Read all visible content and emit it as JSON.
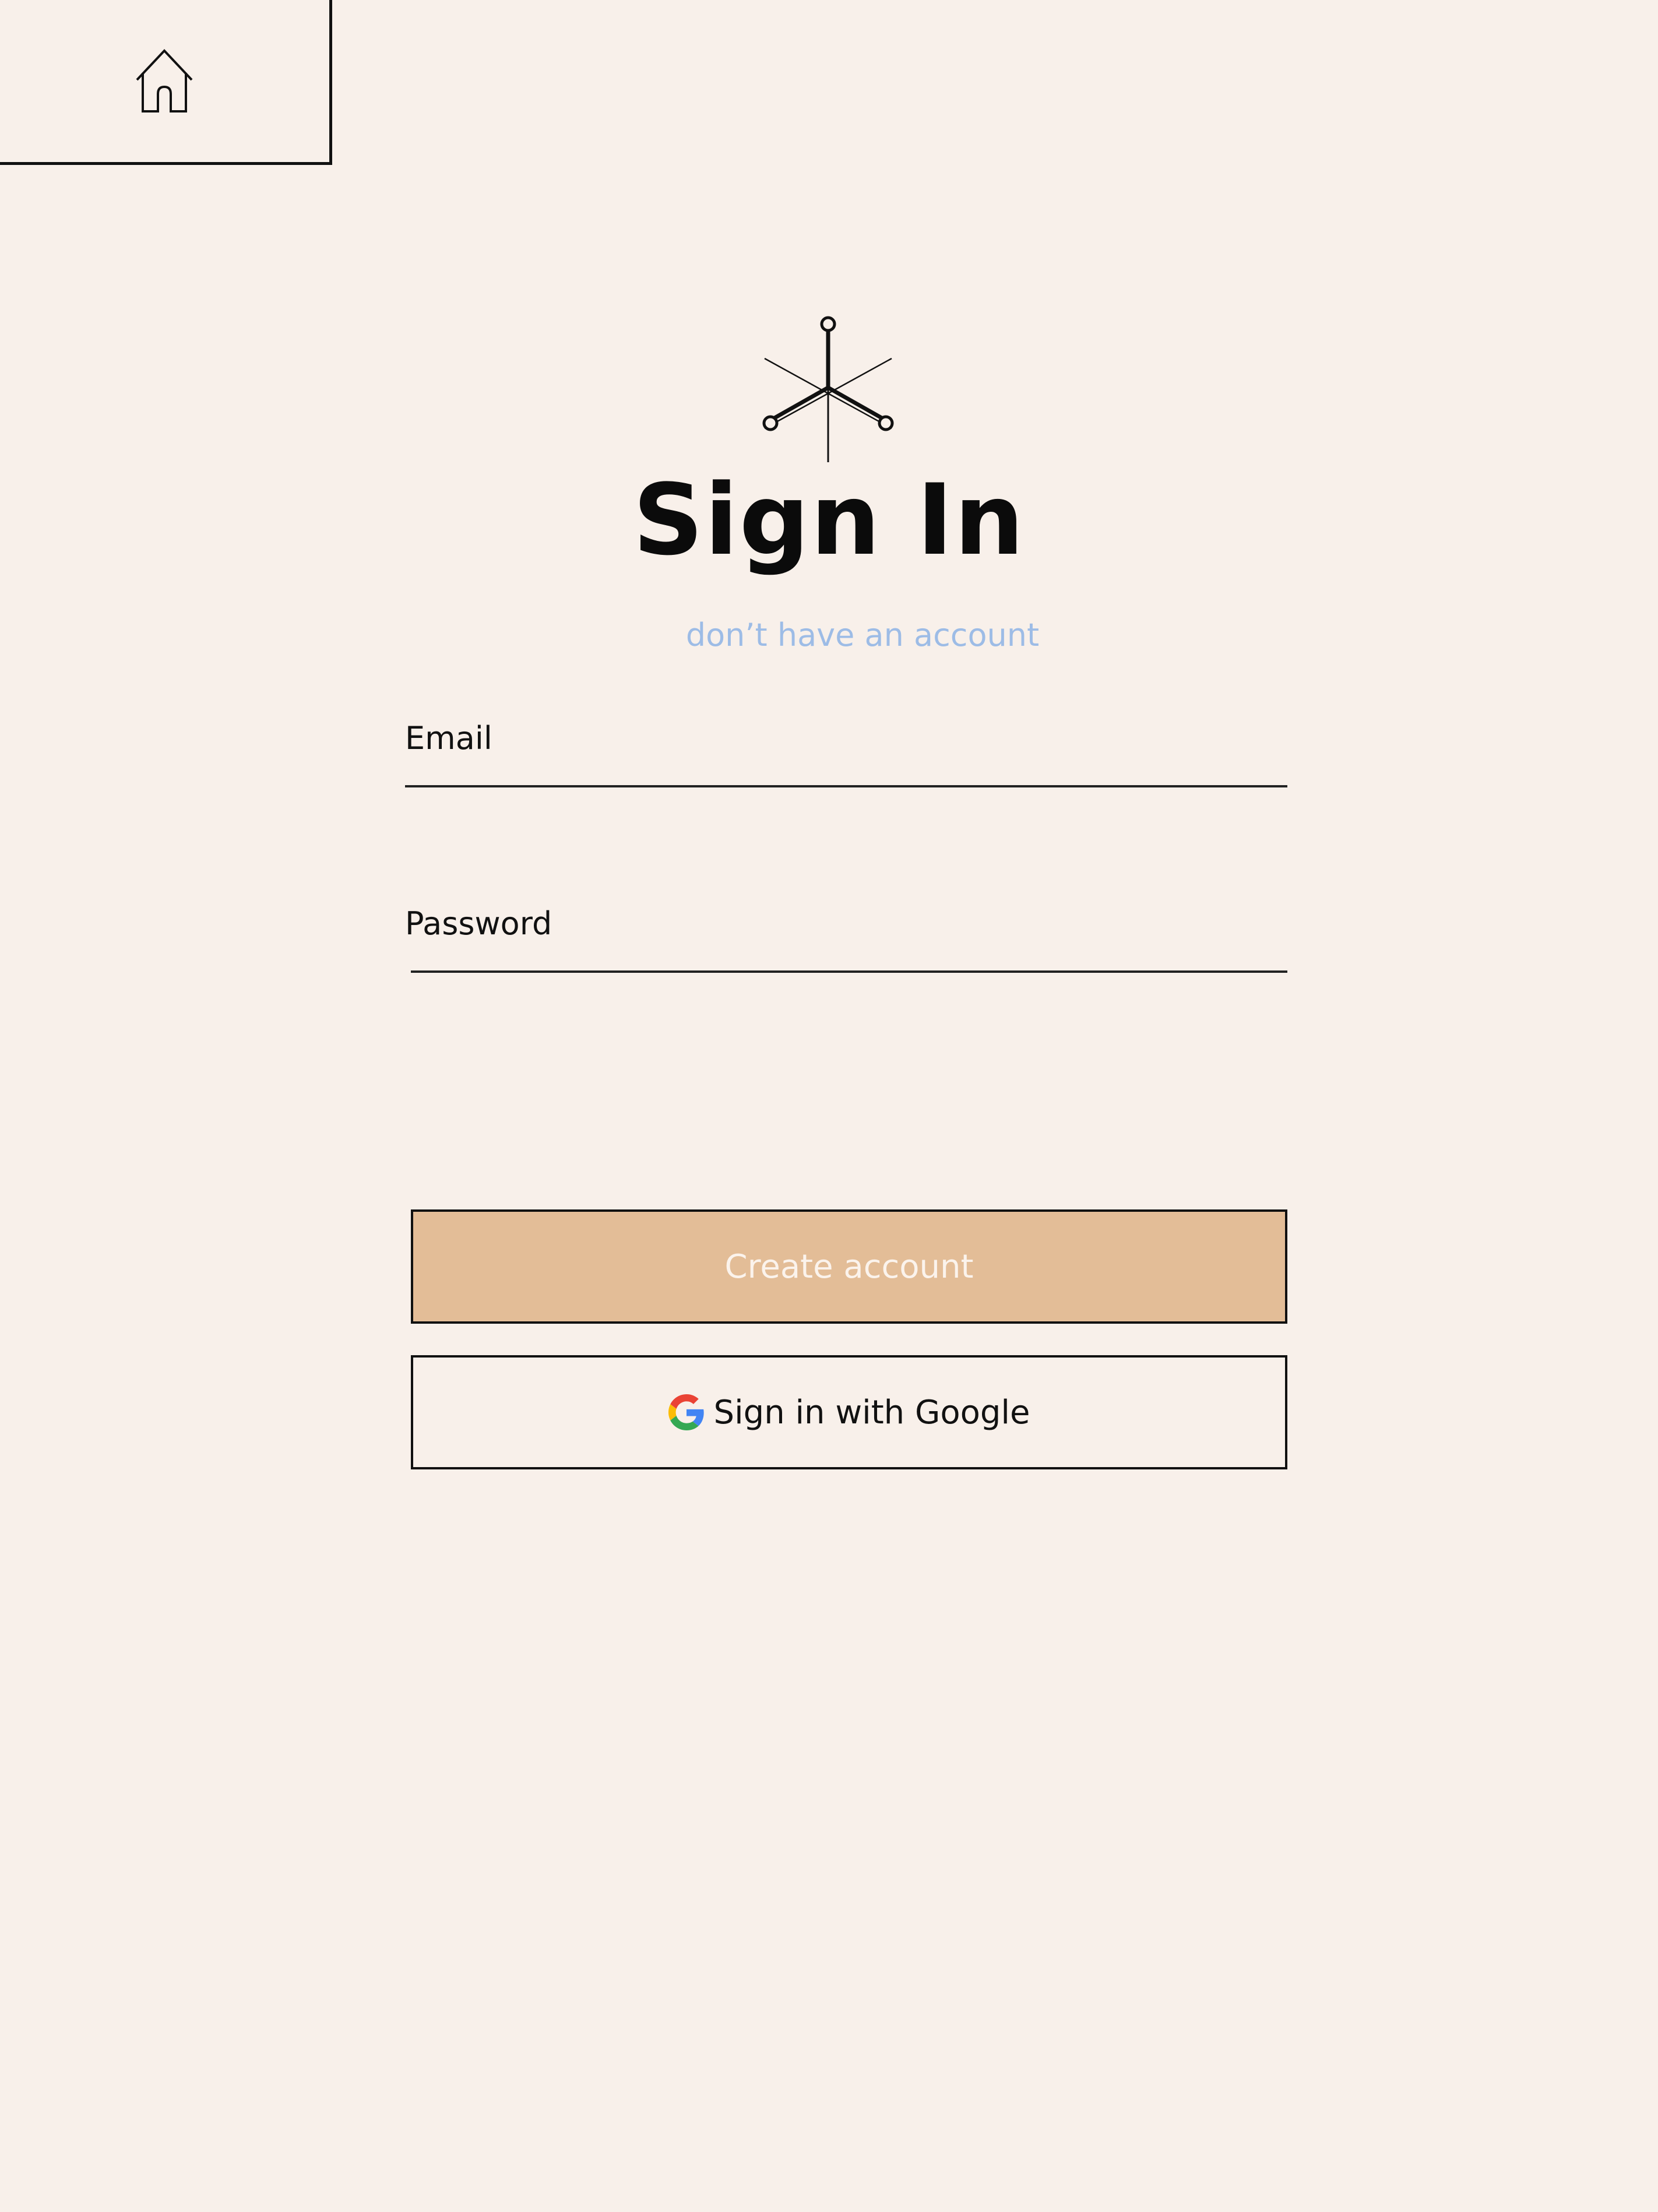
{
  "header": {
    "home_icon": "home-icon"
  },
  "logo": {
    "icon": "asterisk-needles-logo"
  },
  "page": {
    "title": "Sign In",
    "signup_link": "don’t have an account"
  },
  "form": {
    "email_label": "Email",
    "email_value": "",
    "password_label": "Password",
    "password_value": ""
  },
  "buttons": {
    "create_account": "Create account",
    "google_signin": "Sign in with Google",
    "google_icon": "google-g-icon"
  },
  "colors": {
    "background": "#f8f0ea",
    "primary_button": "#e3bd97",
    "link": "#9dbce6",
    "text": "#111111"
  }
}
